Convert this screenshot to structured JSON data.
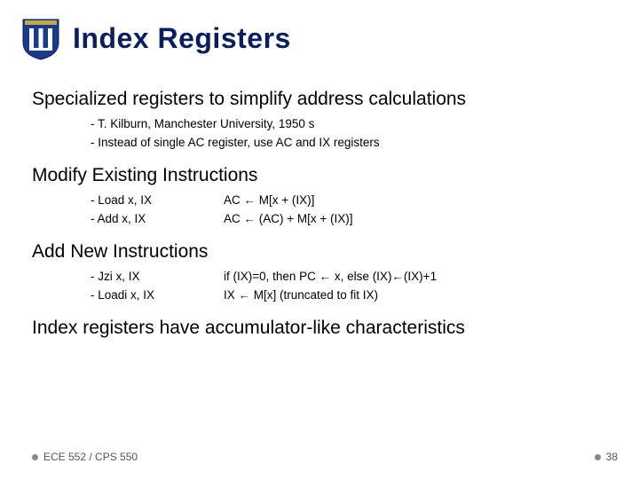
{
  "title": "Index Registers",
  "section1": {
    "heading": "Specialized registers to simplify address calculations",
    "items": [
      "- T. Kilburn, Manchester University, 1950 s",
      "- Instead of single AC register, use AC and IX registers"
    ]
  },
  "section2": {
    "heading": "Modify Existing Instructions",
    "rows": [
      {
        "left": "- Load x, IX",
        "right": "AC ← M[x + (IX)]"
      },
      {
        "left": "- Add x, IX",
        "right": "AC ← (AC) + M[x + (IX)]"
      }
    ]
  },
  "section3": {
    "heading": "Add New Instructions",
    "rows": [
      {
        "left": "- Jzi x, IX",
        "right": "if (IX)=0, then PC ← x, else (IX)←(IX)+1"
      },
      {
        "left": "- Loadi x, IX",
        "right": "IX ← M[x] (truncated to fit IX)"
      }
    ]
  },
  "section4": {
    "heading": "Index registers have accumulator-like characteristics"
  },
  "footer": {
    "course": "ECE 552 / CPS 550",
    "page": "38"
  },
  "logo": {
    "shield_fill": "#1b3a8a",
    "pillar_fill": "#ffffff",
    "top_accent": "#c2a84a"
  }
}
